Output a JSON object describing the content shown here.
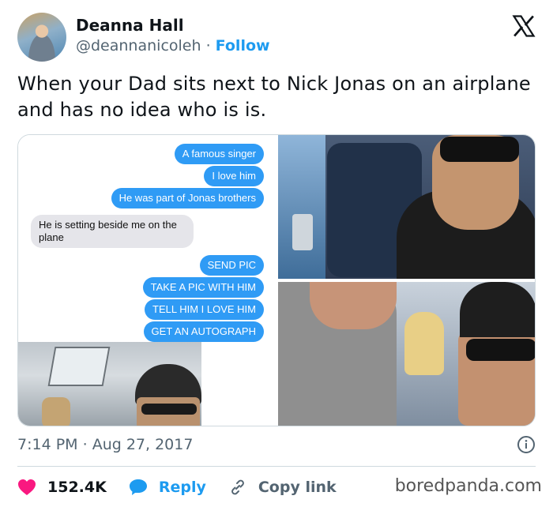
{
  "author": {
    "name": "Deanna Hall",
    "handle": "@deannanicoleh",
    "separator": "·",
    "follow_label": "Follow"
  },
  "platform_icon": "x-logo-icon",
  "tweet": {
    "text": "When your Dad sits next to Nick Jonas on an airplane and has no idea who is is."
  },
  "chat": {
    "messages": [
      {
        "side": "sent",
        "text": "A famous singer"
      },
      {
        "side": "sent",
        "text": "I love him"
      },
      {
        "side": "sent",
        "text": "He was part of Jonas brothers"
      },
      {
        "side": "received",
        "text": "He is setting beside me on the plane"
      },
      {
        "side": "sent",
        "text": "SEND PIC"
      },
      {
        "side": "sent",
        "text": "TAKE A PIC WITH HIM"
      },
      {
        "side": "sent",
        "text": "TELL HIM I LOVE HIM"
      },
      {
        "side": "sent",
        "text": "GET AN AUTOGRAPH"
      }
    ]
  },
  "meta": {
    "time": "7:14 PM",
    "separator": "·",
    "date": "Aug 27, 2017"
  },
  "actions": {
    "likes": "152.4K",
    "reply_label": "Reply",
    "copy_link_label": "Copy link"
  },
  "watermark": "boredpanda.com",
  "colors": {
    "accent": "#1d9bf0",
    "like": "#f91880",
    "imessage_blue": "#2f9bf5"
  }
}
